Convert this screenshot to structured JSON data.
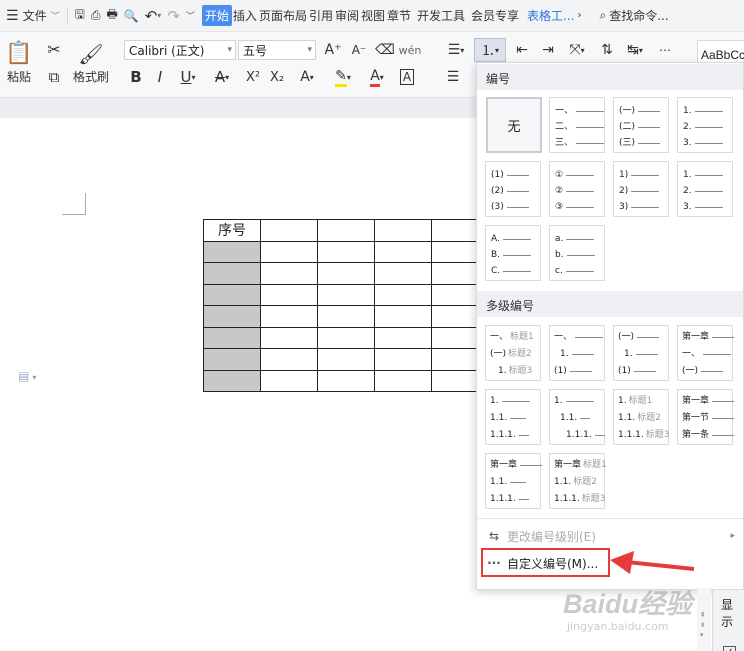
{
  "topbar": {
    "menu_label": "文件",
    "tabs": [
      "开始",
      "插入",
      "页面布局",
      "引用",
      "审阅",
      "视图",
      "章节",
      "开发工具",
      "会员专享",
      "表格工..."
    ],
    "search_label": "查找命令..."
  },
  "ribbon": {
    "paste_label": "粘贴",
    "format_painter_label": "格式刷",
    "font_name": "Calibri (正文)",
    "font_size": "五号",
    "style_preview": "AaBbCcDd"
  },
  "table": {
    "header": "序号",
    "cols": 5,
    "rows": 8
  },
  "dropdown": {
    "section_numbering": "编号",
    "section_multilevel": "多级编号",
    "none_label": "无",
    "numbering_tiles": [
      {
        "lines": [
          "一、",
          "二、",
          "三、"
        ]
      },
      {
        "lines": [
          "(一)",
          "(二)",
          "(三)"
        ]
      },
      {
        "lines": [
          "1.",
          "2.",
          "3."
        ]
      },
      {
        "lines": [
          "(1)",
          "(2)",
          "(3)"
        ]
      },
      {
        "lines": [
          "①",
          "②",
          "③"
        ]
      },
      {
        "lines": [
          "1)",
          "2)",
          "3)"
        ]
      },
      {
        "lines": [
          "1.",
          "2.",
          "3."
        ]
      },
      {
        "lines": [
          "A.",
          "B.",
          "C."
        ]
      },
      {
        "lines": [
          "a.",
          "b.",
          "c."
        ]
      }
    ],
    "multilevel_tiles": [
      {
        "lines": [
          [
            "一、",
            "标题1"
          ],
          [
            "(一)",
            "标题2"
          ],
          [
            "1.",
            "标题3"
          ]
        ]
      },
      {
        "lines": [
          [
            "一、",
            ""
          ],
          [
            "1.",
            ""
          ],
          [
            "(1)",
            ""
          ]
        ]
      },
      {
        "lines": [
          [
            "(一)",
            ""
          ],
          [
            "1.",
            ""
          ],
          [
            "(1)",
            ""
          ]
        ]
      },
      {
        "lines": [
          [
            "第一章",
            ""
          ],
          [
            "一、",
            ""
          ],
          [
            "(一)",
            ""
          ]
        ]
      },
      {
        "lines": [
          [
            "1.",
            ""
          ],
          [
            "1.1.",
            ""
          ],
          [
            "1.1.1.",
            ""
          ]
        ]
      },
      {
        "lines": [
          [
            "1.",
            ""
          ],
          [
            "1.1.",
            ""
          ],
          [
            "1.1.1.",
            ""
          ]
        ]
      },
      {
        "lines": [
          [
            "1.",
            "标题1"
          ],
          [
            "1.1.",
            "标题2"
          ],
          [
            "1.1.1.",
            "标题3"
          ]
        ]
      },
      {
        "lines": [
          [
            "第一章",
            ""
          ],
          [
            "第一节",
            ""
          ],
          [
            "第一条",
            ""
          ]
        ]
      },
      {
        "lines": [
          [
            "第一章",
            ""
          ],
          [
            "1.1.",
            ""
          ],
          [
            "1.1.1.",
            ""
          ]
        ]
      },
      {
        "lines": [
          [
            "第一章",
            "标题1"
          ],
          [
            "1.1.",
            "标题2"
          ],
          [
            "1.1.1.",
            "标题3"
          ]
        ]
      }
    ],
    "change_level_label": "更改编号级别(E)",
    "custom_label": "自定义编号(M)..."
  },
  "side_panel": {
    "label": "显示"
  },
  "watermark": {
    "text": "Baidu经验",
    "sub": "jingyan.baidu.com"
  },
  "colors": {
    "accent": "#4a8ef0",
    "highlight": "#e53b3b",
    "gray_cell": "#c8c8c8"
  }
}
